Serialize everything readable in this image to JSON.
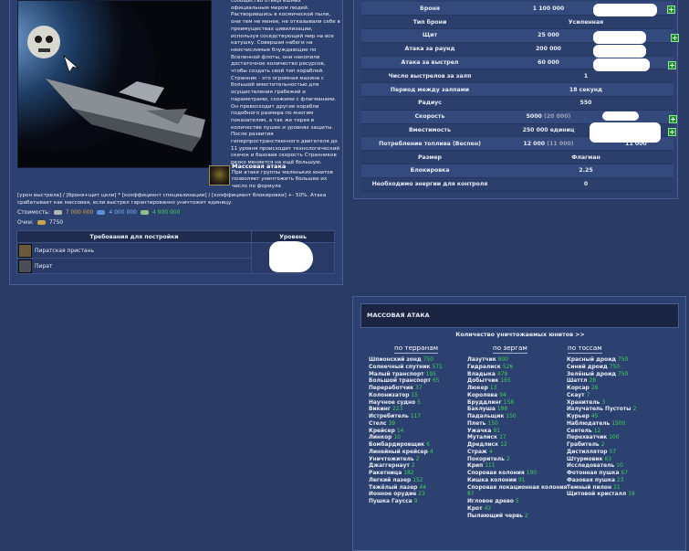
{
  "ship": {
    "description": "сообщество отверги­шных официальным миром людей. Растворившись в космической пыли, они тем не менее, не отказывали себе в преимуществах цивилизации, используя соседствующий мир на все катушку. Совершая набеги на неисчислимые блуждающие по Вселенной флоты, они накопили достаточное количество ресурсов, чтобы создать свой тип кораблей. Странник - это огромная махина с большой вместительностью для осуществления грабежей и параметрами, схожими с флагманами. Он превосходит другие корабли подобного размера по многим показателям, а так же теряя в количестве пушек и уровнях защиты. После развития гиперпространственного двигателя до 11 уровня происходит технологический скачок и базовая скорость Странников резко меняется на ещё большую.",
    "ability_title": "Массовая атака",
    "ability_text": "При атаке группы маленьких юнитов позволяет уничтожить большее их число по формуле",
    "formula": "[урон выстрела] / [броня+щит цели] * [коэффициент специализации] / [коэффициент блокировки] +- 50%. Атака срабатывает как массовая, если выстрел гарантированно уничтожит единицу.",
    "cost_label": "Стоимость:",
    "cost_metal": "7 000 000",
    "cost_crystal": "4 000 000",
    "cost_deut": "4 000 000",
    "score_label": "Очки:",
    "score_value": "7750",
    "req_header": "Требования для постройки",
    "level_header": "Уровень",
    "requirements": [
      "Пиратская пристань",
      "Пират"
    ]
  },
  "stats": [
    {
      "label": "Броня",
      "value": "1 100 000",
      "extra": ""
    },
    {
      "label": "Тип брони",
      "value": "Усиленная",
      "extra": ""
    },
    {
      "label": "Щит",
      "value": "25 000",
      "extra": ""
    },
    {
      "label": "Атака за раунд",
      "value": "200 000",
      "extra": ""
    },
    {
      "label": "Атака за выстрел",
      "value": "60 000",
      "extra": ""
    },
    {
      "label": "Число выстрелов за залп",
      "value": "1",
      "extra": ""
    },
    {
      "label": "Период между залпами",
      "value": "18 секунд",
      "extra": ""
    },
    {
      "label": "Радиус",
      "value": "550",
      "extra": ""
    },
    {
      "label": "Скорость",
      "value": "5000",
      "extra": "(20 000)"
    },
    {
      "label": "Вместимость",
      "value": "250 000 единиц",
      "extra": ""
    },
    {
      "label": "Потребление топлива (Веспен)",
      "value": "12 000",
      "extra": "(11 000)",
      "value2": "11 000"
    },
    {
      "label": "Размер",
      "value": "Флагман",
      "extra": ""
    },
    {
      "label": "Блокировка",
      "value": "2.25",
      "extra": ""
    },
    {
      "label": "Необходимо энергии для контроля",
      "value": "0",
      "extra": ""
    }
  ],
  "mass_attack": {
    "title": "МАССОВАЯ АТАКА",
    "subtitle": "Количество уничтожаемых юнитов >>",
    "columns": [
      {
        "header": "по терранам",
        "units": [
          {
            "name": "Шпионский зонд",
            "count": "750"
          },
          {
            "name": "Солнечный спутник",
            "count": "571"
          },
          {
            "name": "Малый транспорт",
            "count": "195"
          },
          {
            "name": "Большой транспорт",
            "count": "65"
          },
          {
            "name": "Переработчик",
            "count": "37"
          },
          {
            "name": "Колонизатор",
            "count": "15"
          },
          {
            "name": "Научное судно",
            "count": "5"
          },
          {
            "name": "Викинг",
            "count": "223"
          },
          {
            "name": "Истребитель",
            "count": "117"
          },
          {
            "name": "Стелс",
            "count": "39"
          },
          {
            "name": "Крейсер",
            "count": "14"
          },
          {
            "name": "Линкор",
            "count": "10"
          },
          {
            "name": "Бомбардировщик",
            "count": "6"
          },
          {
            "name": "Линейный крейсер",
            "count": "4"
          },
          {
            "name": "Уничтожитель",
            "count": "2"
          },
          {
            "name": "Джаггернаут",
            "count": "2"
          },
          {
            "name": "Ракетница",
            "count": "182"
          },
          {
            "name": "Легкий лазер",
            "count": "152"
          },
          {
            "name": "Тяжёлый лазер",
            "count": "44"
          },
          {
            "name": "Ионное орудие",
            "count": "23"
          },
          {
            "name": "Пушка Гаусса",
            "count": "9"
          }
        ]
      },
      {
        "header": "по зергам",
        "units": [
          {
            "name": "Лазутчик",
            "count": "800"
          },
          {
            "name": "Гидралиск",
            "count": "526"
          },
          {
            "name": "Владыка",
            "count": "479"
          },
          {
            "name": "Добытчик",
            "count": "165"
          },
          {
            "name": "Люкер",
            "count": "13"
          },
          {
            "name": "Королева",
            "count": "94"
          },
          {
            "name": "Бруддлинг",
            "count": "158"
          },
          {
            "name": "Баклуша",
            "count": "188"
          },
          {
            "name": "Падальщик",
            "count": "150"
          },
          {
            "name": "Плеть",
            "count": "150"
          },
          {
            "name": "Ужачка",
            "count": "91"
          },
          {
            "name": "Муталиск",
            "count": "17"
          },
          {
            "name": "Дредлиск",
            "count": "12"
          },
          {
            "name": "Страж",
            "count": "4"
          },
          {
            "name": "Покоритель",
            "count": "2"
          },
          {
            "name": "Крип",
            "count": "111"
          },
          {
            "name": "Споровая колония",
            "count": "190"
          },
          {
            "name": "Кишка колонии",
            "count": "91"
          },
          {
            "name": "Споровая локационная колония",
            "count": "87"
          },
          {
            "name": "Игловое древо",
            "count": "5"
          },
          {
            "name": "Крот",
            "count": "43"
          },
          {
            "name": "Пылающий червь",
            "count": "2"
          }
        ]
      },
      {
        "header": "по тоссам",
        "units": [
          {
            "name": "Красный дроид",
            "count": "750"
          },
          {
            "name": "Синий дроид",
            "count": "750"
          },
          {
            "name": "Зелёный дроид",
            "count": "750"
          },
          {
            "name": "Шаттл",
            "count": "28"
          },
          {
            "name": "Корсар",
            "count": "26"
          },
          {
            "name": "Скаут",
            "count": "7"
          },
          {
            "name": "Хранитель",
            "count": "3"
          },
          {
            "name": "Излучатель Пустоты",
            "count": "2"
          },
          {
            "name": "Курьер",
            "count": "45"
          },
          {
            "name": "Наблюдатель",
            "count": "1500"
          },
          {
            "name": "Сеятель",
            "count": "12"
          },
          {
            "name": "Перехватчик",
            "count": "100"
          },
          {
            "name": "Грабитель",
            "count": "2"
          },
          {
            "name": "Дистиллятор",
            "count": "57"
          },
          {
            "name": "Штурмовик",
            "count": "83"
          },
          {
            "name": "Исследователь",
            "count": "10"
          },
          {
            "name": "Фотонная пушка",
            "count": "67"
          },
          {
            "name": "Фазовая пушка",
            "count": "23"
          },
          {
            "name": "Темный пилон",
            "count": "21"
          },
          {
            "name": "Щитовой кристалл",
            "count": "19"
          }
        ]
      }
    ]
  }
}
